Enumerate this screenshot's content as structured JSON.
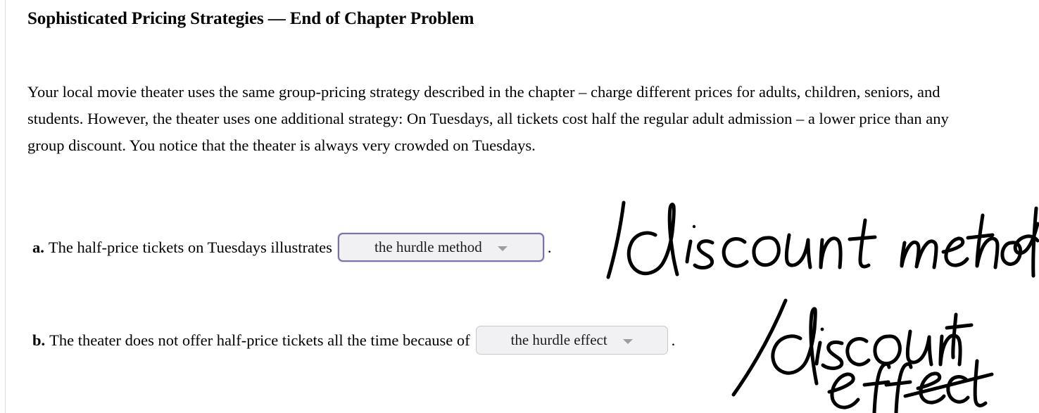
{
  "document": {
    "title": "Sophisticated Pricing Strategies — End of Chapter Problem",
    "scenario": "Your local movie theater uses the same group-pricing strategy described in the chapter – charge different prices for adults, children, seniors, and students. However, the theater uses one additional strategy: On Tuesdays, all tickets cost half the regular adult admission – a lower price than any group discount. You notice that the theater is always very crowded on Tuesdays."
  },
  "questions": [
    {
      "label": "a.",
      "prompt": "The half-price tickets on Tuesdays illustrates",
      "dropdown": {
        "selected": "the hurdle method",
        "caret": "chevron-down-icon",
        "state": "focused",
        "border_color": "#7d72a8",
        "background_color": "#f1f1f3"
      },
      "trailing_punctuation": "."
    },
    {
      "label": "b.",
      "prompt": "The theater does not offer half-price tickets all the time because of",
      "dropdown": {
        "selected": "the hurdle effect",
        "caret": "chevron-down-icon",
        "state": "default",
        "border_color": "#c8c8cc",
        "background_color": "#f1f1f3"
      },
      "trailing_punctuation": "."
    }
  ],
  "annotations": [
    {
      "id": "annotation-a",
      "text": "/discount method",
      "ink_color": "#000000",
      "note": "handwritten correction beside question a, clipped at right edge"
    },
    {
      "id": "annotation-b",
      "text": "/discount effect",
      "ink_color": "#000000",
      "note": "handwritten correction beside question b, written on two lines, clipped at bottom"
    }
  ]
}
